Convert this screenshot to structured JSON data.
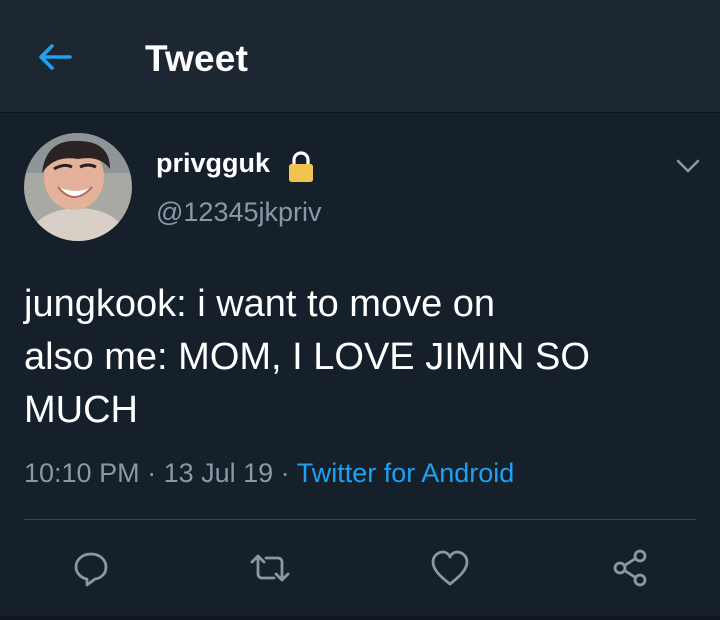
{
  "header": {
    "title": "Tweet",
    "back_icon": "back-arrow-icon"
  },
  "author": {
    "display_name": "privgguk",
    "handle": "@12345jkpriv",
    "protected_icon": "lock-icon"
  },
  "tweet": {
    "lines": [
      "jungkook: i want to move on",
      "also me: MOM, I LOVE JIMIN SO",
      "MUCH"
    ],
    "time": "10:10 PM",
    "date": "13 Jul 19",
    "separator": " · ",
    "source": "Twitter for Android"
  },
  "actions": [
    {
      "name": "reply",
      "icon": "reply-icon"
    },
    {
      "name": "retweet",
      "icon": "retweet-icon"
    },
    {
      "name": "like",
      "icon": "heart-icon"
    },
    {
      "name": "share",
      "icon": "share-icon"
    }
  ],
  "colors": {
    "background": "#15202b",
    "header_background": "#1c2732",
    "accent": "#1da1f2",
    "secondary_text": "#8899a6",
    "divider": "#38444d"
  }
}
